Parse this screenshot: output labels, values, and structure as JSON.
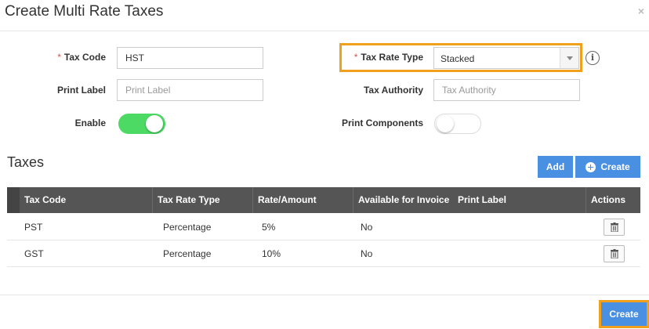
{
  "modal": {
    "title": "Create Multi Rate Taxes",
    "close_label": "×"
  },
  "form": {
    "required_mark": "*",
    "tax_code": {
      "label": "Tax Code",
      "value": "HST"
    },
    "print_label": {
      "label": "Print Label",
      "placeholder": "Print Label"
    },
    "enable": {
      "label": "Enable",
      "state": "on"
    },
    "tax_rate_type": {
      "label": "Tax Rate Type",
      "value": "Stacked"
    },
    "tax_authority": {
      "label": "Tax Authority",
      "placeholder": "Tax Authority"
    },
    "print_components": {
      "label": "Print Components",
      "state": "off"
    },
    "info_glyph": "i"
  },
  "taxes": {
    "title": "Taxes",
    "add_label": "Add",
    "create_label": "Create",
    "columns": [
      "Tax Code",
      "Tax Rate Type",
      "Rate/Amount",
      "Available for Invoice",
      "Print Label",
      "Actions"
    ],
    "rows": [
      {
        "tax_code": "PST",
        "tax_rate_type": "Percentage",
        "rate": "5%",
        "available": "No",
        "print_label": ""
      },
      {
        "tax_code": "GST",
        "tax_rate_type": "Percentage",
        "rate": "10%",
        "available": "No",
        "print_label": ""
      }
    ]
  },
  "footer": {
    "create_label": "Create"
  },
  "colors": {
    "accent": "#4a90e2",
    "highlight": "#f0a01c",
    "toggle_on": "#4cd964",
    "table_header": "#555555",
    "required": "#d9534f"
  }
}
